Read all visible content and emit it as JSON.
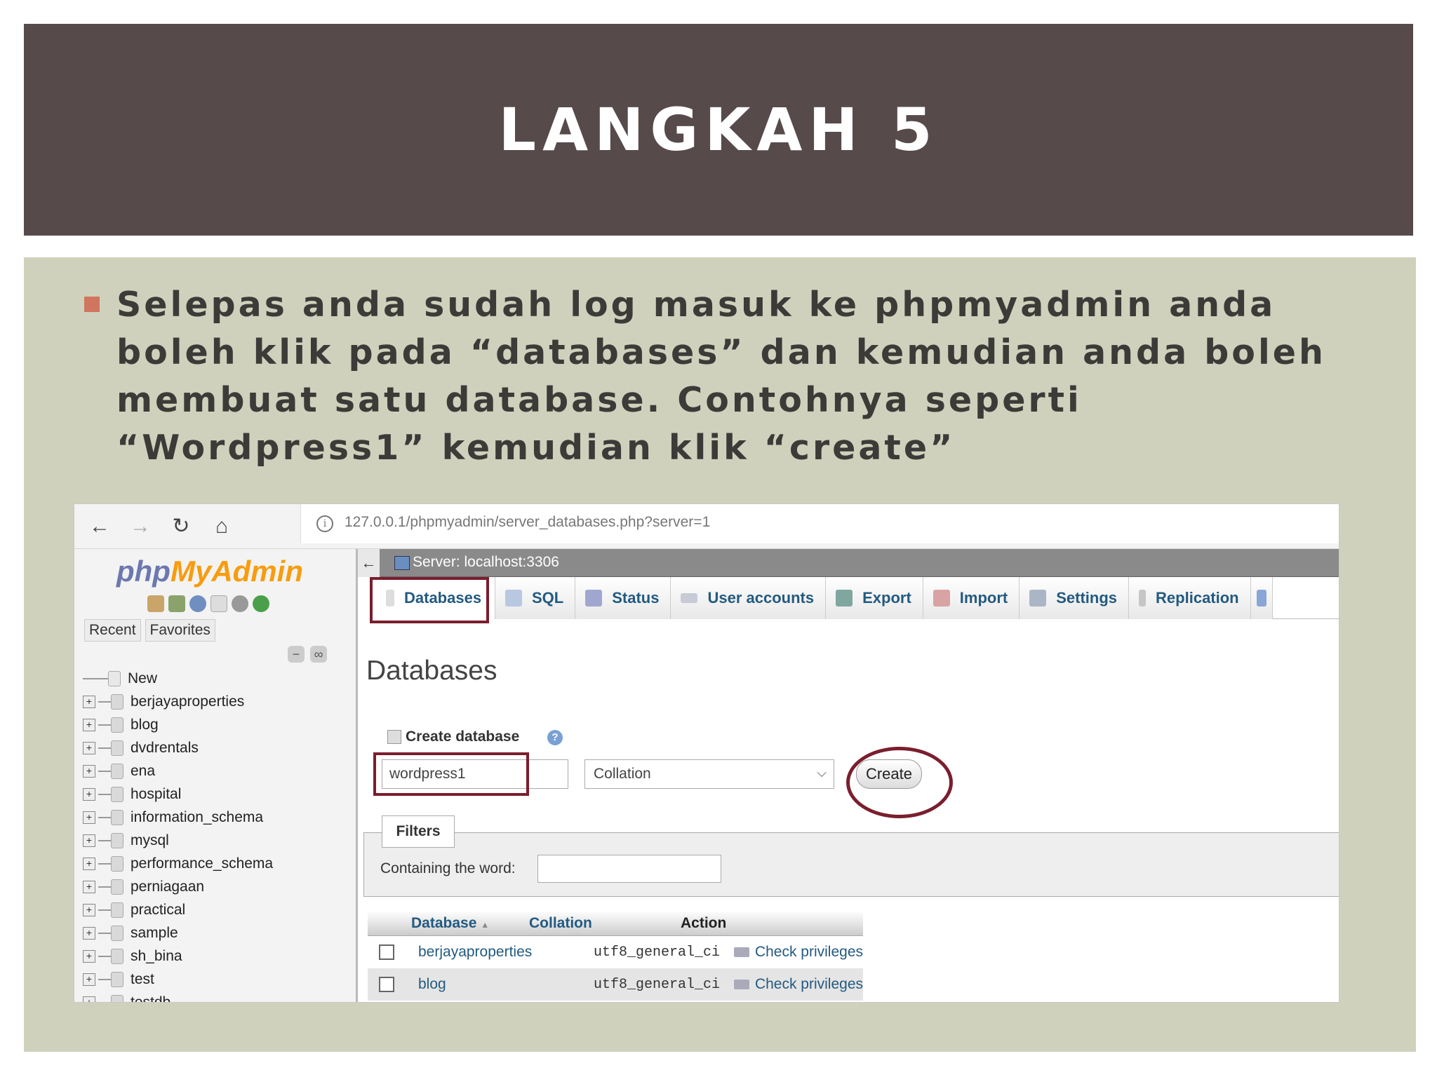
{
  "slide": {
    "title": "LANGKAH 5",
    "bullet": "Selepas anda sudah log masuk ke phpmyadmin anda boleh klik pada “databases” dan kemudian anda boleh membuat satu database. Contohnya seperti “Wordpress1” kemudian klik “create”"
  },
  "browser": {
    "url": "127.0.0.1/phpmyadmin/server_databases.php?server=1"
  },
  "sidebar": {
    "logo_php": "php",
    "logo_myadmin": "MyAdmin",
    "tabs": [
      "Recent",
      "Favorites"
    ],
    "new_label": "New",
    "databases": [
      "berjayaproperties",
      "blog",
      "dvdrentals",
      "ena",
      "hospital",
      "information_schema",
      "mysql",
      "performance_schema",
      "perniagaan",
      "practical",
      "sample",
      "sh_bina",
      "test",
      "testdb"
    ]
  },
  "main": {
    "server_label": "Server: localhost:3306",
    "tabs": [
      "Databases",
      "SQL",
      "Status",
      "User accounts",
      "Export",
      "Import",
      "Settings",
      "Replication"
    ],
    "page_title": "Databases",
    "create_label": "Create database",
    "db_name_value": "wordpress1",
    "collation_placeholder": "Collation",
    "create_button": "Create",
    "filters_label": "Filters",
    "containing_label": "Containing the word:",
    "table": {
      "headers": [
        "Database",
        "Collation",
        "Action"
      ],
      "sort_indicator": "▲",
      "rows": [
        {
          "name": "berjayaproperties",
          "collation": "utf8_general_ci",
          "action": "Check privileges"
        },
        {
          "name": "blog",
          "collation": "utf8_general_ci",
          "action": "Check privileges"
        }
      ]
    }
  },
  "colors": {
    "title_band": "#564a4b",
    "body_band": "#cfd1bc",
    "bullet": "#d0765f",
    "highlight": "#7a1e2e",
    "link": "#235a81"
  }
}
